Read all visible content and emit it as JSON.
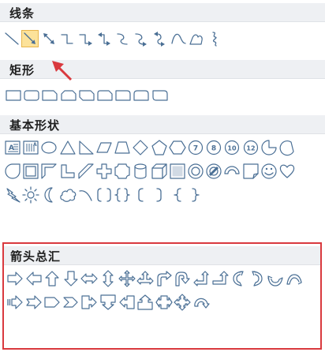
{
  "sections": {
    "lines": {
      "title": "线条"
    },
    "rect": {
      "title": "矩形"
    },
    "basic": {
      "title": "基本形状"
    },
    "arrows": {
      "title": "箭头总汇"
    }
  },
  "colors": {
    "shape_stroke": "#4a6f95",
    "shape_fill": "#ffffff",
    "selection_fill": "#fce29a",
    "selection_border": "#e8b54b",
    "highlight_red": "#d9393e",
    "header_bg": "#eef0f3"
  },
  "icons": {
    "lines": [
      "line-icon",
      "arrow-line-icon",
      "double-arrow-line-icon",
      "elbow-connector-icon",
      "elbow-arrow-connector-icon",
      "elbow-double-arrow-connector-icon",
      "curved-connector-icon",
      "curved-arrow-connector-icon",
      "curved-double-arrow-connector-icon",
      "curve-icon",
      "freeform-icon",
      "scribble-icon"
    ],
    "rect": [
      "rectangle-icon",
      "rounded-rectangle-icon",
      "snip-single-corner-rectangle-icon",
      "snip-same-side-rectangle-icon",
      "snip-diagonal-rectangle-icon",
      "snip-round-rectangle-icon",
      "round-single-corner-rectangle-icon",
      "round-same-side-rectangle-icon",
      "round-diagonal-rectangle-icon"
    ],
    "basic": [
      "text-box-icon",
      "vertical-text-box-icon",
      "oval-icon",
      "triangle-icon",
      "right-triangle-icon",
      "parallelogram-icon",
      "trapezoid-icon",
      "diamond-icon",
      "pentagon-icon",
      "hexagon-icon",
      "heptagon-icon",
      "octagon-icon",
      "decagon-icon",
      "dodecagon-icon",
      "pie-icon",
      "chord-icon",
      "teardrop-icon",
      "frame-icon",
      "half-frame-icon",
      "l-shape-icon",
      "diagonal-stripe-icon",
      "cross-icon",
      "plaque-icon",
      "can-icon",
      "cube-icon",
      "bevel-icon",
      "donut-icon",
      "no-symbol-icon",
      "block-arc-icon",
      "folded-corner-icon",
      "smiley-face-icon",
      "heart-icon",
      "lightning-bolt-icon",
      "sun-icon",
      "moon-icon",
      "cloud-icon",
      "arc-icon",
      "double-bracket-icon",
      "double-brace-icon",
      "left-bracket-icon",
      "right-bracket-icon",
      "left-brace-icon",
      "right-brace-icon"
    ],
    "arrows": [
      "right-arrow-icon",
      "left-arrow-icon",
      "up-arrow-icon",
      "down-arrow-icon",
      "left-right-arrow-icon",
      "up-down-arrow-icon",
      "quad-arrow-icon",
      "left-right-up-arrow-icon",
      "bent-arrow-icon",
      "u-turn-arrow-icon",
      "left-up-arrow-icon",
      "bent-up-arrow-icon",
      "curved-right-arrow-icon",
      "curved-left-arrow-icon",
      "curved-up-arrow-icon",
      "curved-down-arrow-icon",
      "striped-right-arrow-icon",
      "notched-right-arrow-icon",
      "pentagon-arrow-icon",
      "chevron-arrow-icon",
      "right-arrow-callout-icon",
      "down-arrow-callout-icon",
      "left-arrow-callout-icon",
      "up-arrow-callout-icon",
      "left-right-arrow-callout-icon",
      "quad-arrow-callout-icon",
      "circular-arrow-icon"
    ]
  },
  "badges": {
    "heptagon": "7",
    "octagon": "8",
    "decagon": "10",
    "dodecagon": "12"
  }
}
